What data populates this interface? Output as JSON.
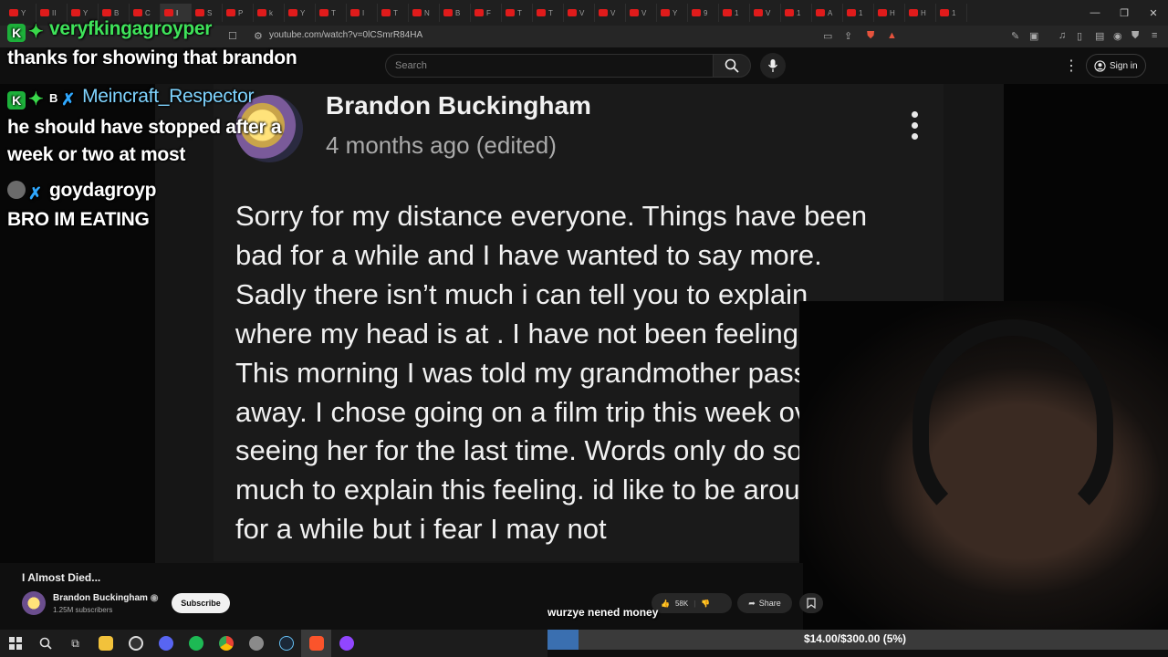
{
  "browser": {
    "url": "youtube.com/watch?v=0lCSmrR84HA",
    "tabs": [
      "Y",
      "II",
      "Y",
      "B",
      "C",
      "I",
      "S",
      "P",
      "k",
      "Y",
      "T",
      "I",
      "T",
      "N",
      "B",
      "F",
      "T",
      "T",
      "V",
      "V",
      "V",
      "Y",
      "9",
      "1",
      "V",
      "1",
      "A",
      "1",
      "H",
      "H",
      "1"
    ],
    "window_controls": [
      "—",
      "❐",
      "✕"
    ]
  },
  "youtube_header": {
    "search_placeholder": "Search",
    "sign_in_label": "Sign in"
  },
  "chat": [
    {
      "user": "veryfkingagroyper",
      "message": "thanks for showing that brandon",
      "user_color": "#3fe35a"
    },
    {
      "user": "Meincraft_Respector",
      "message": "he should have stopped after a week or two at most",
      "user_color": "#7fd4ff"
    },
    {
      "user": "goydagroyp",
      "message": "BRO IM EATING",
      "user_color": "#ffffff"
    }
  ],
  "chat_badge_text": "B",
  "comment": {
    "author": "Brandon Buckingham",
    "timestamp": "4 months ago (edited)",
    "lines": [
      "Sorry for my distance everyone. Things have been",
      "bad for a while and I have wanted to say more.",
      "Sadly there isn’t much i can tell you to explain",
      "where my head is at . I have not been feeling okay.",
      "This morning I was told my grandmother passed",
      "away. I chose going on a film trip this week over",
      "seeing her for the last time. Words only do so",
      "much to explain this feeling. id like to be around",
      "for a while but i fear I may not"
    ]
  },
  "video": {
    "title": "I Almost Died...",
    "channel": "Brandon Buckingham",
    "subscribers": "1.25M subscribers",
    "subscribe_label": "Subscribe",
    "likes": "58K",
    "share_label": "Share"
  },
  "overlay_text": "wurzye nened money",
  "donation_goal": {
    "text": "$14.00/$300.00 (5%)",
    "fraction": 0.05
  },
  "colors": {
    "accent_green": "#3fe35a",
    "accent_blue": "#7fd4ff",
    "goal_fill": "#3a6fb0"
  }
}
